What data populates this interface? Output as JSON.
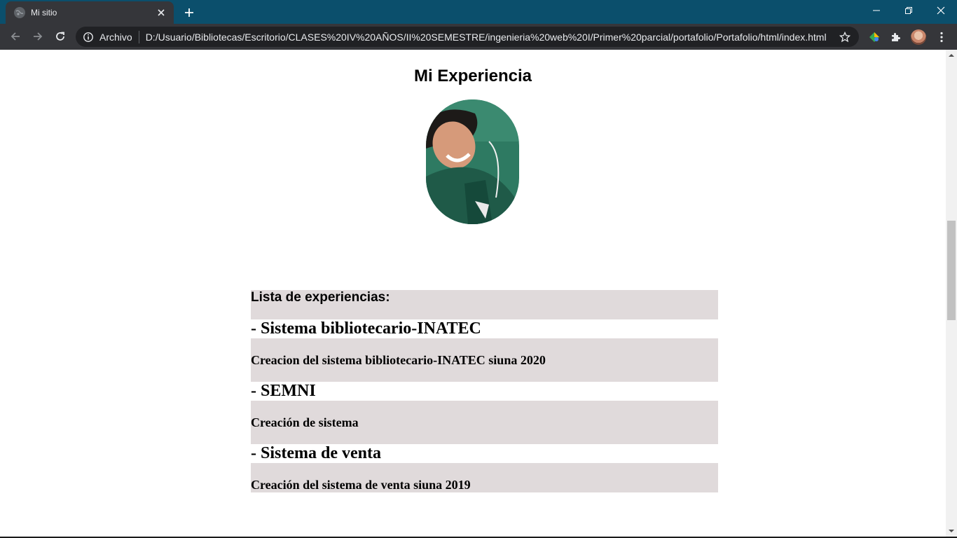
{
  "browser": {
    "tab_title": "Mi sitio",
    "site_chip": "Archivo",
    "url": "D:/Usuario/Bibliotecas/Escritorio/CLASES%20IV%20AÑOS/II%20SEMESTRE/ingenieria%20web%20I/Primer%20parcial/portafolio/Portafolio/html/index.html",
    "icons": {
      "favicon": "globe-icon",
      "tab_close": "close-icon",
      "new_tab": "plus-icon",
      "back": "arrow-left-icon",
      "forward": "arrow-right-icon",
      "reload": "reload-icon",
      "info": "info-icon",
      "bookmark": "star-icon",
      "extensions": "puzzle-icon"
    },
    "colors": {
      "titlebar": "#0b4f6c",
      "toolbar": "#35363a",
      "omnibox": "#202124"
    }
  },
  "page": {
    "heading": "Mi Experiencia",
    "experience": {
      "header": "Lista de experiencias:",
      "items": [
        {
          "title": "- Sistema bibliotecario-INATEC",
          "description": "Creacion del sistema bibliotecario-INATEC siuna 2020"
        },
        {
          "title": "- SEMNI",
          "description": "Creación de sistema"
        },
        {
          "title": "- Sistema de venta",
          "description": "Creación del sistema de venta siuna 2019"
        }
      ]
    },
    "colors": {
      "row_background": "#e0dadb"
    }
  }
}
